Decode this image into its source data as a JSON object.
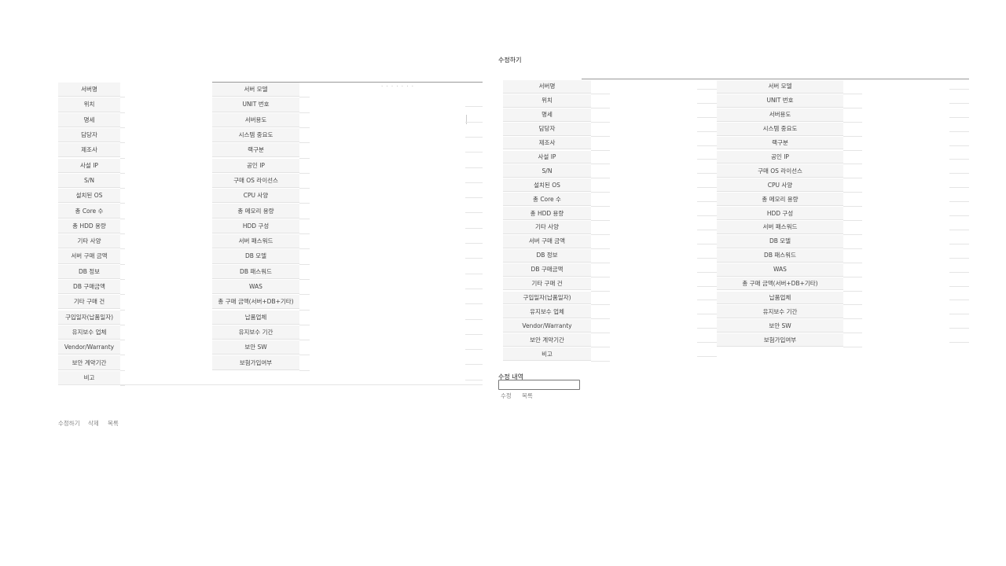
{
  "detail": {
    "left_labels": [
      "서버명",
      "위치",
      "명세",
      "담당자",
      "제조사",
      "사설 IP",
      "S/N",
      "설치된 OS",
      "총 Core 수",
      "총 HDD 용량",
      "기타 사양",
      "서버 구매 금액",
      "DB 정보",
      "DB 구매금액",
      "기타 구매 건",
      "구입일자(납품일자)",
      "유지보수 업체",
      "Vendor/Warranty",
      "보안 계약기간",
      "비고"
    ],
    "right_labels": [
      "서버 모델",
      "UNIT 번호",
      "서버용도",
      "시스템 중요도",
      "랙구분",
      "공인 IP",
      "구매 OS 라이선스",
      "CPU 사양",
      "총 메모리 용량",
      "HDD 구성",
      "서버 패스워드",
      "DB 모델",
      "DB 패스워드",
      "WAS",
      "총 구매 금액(서버+DB+기타)",
      "납품업체",
      "유지보수 기간",
      "보안 SW",
      "보험가입여부"
    ],
    "dots": "· · · · · · ·",
    "actions": {
      "edit": "수정하기",
      "delete": "삭제",
      "list": "목록"
    }
  },
  "edit": {
    "title": "수정하기",
    "left_labels": [
      "서버명",
      "위치",
      "명세",
      "담당자",
      "제조사",
      "사설 IP",
      "S/N",
      "설치된 OS",
      "총 Core 수",
      "총 HDD 용량",
      "기타 사양",
      "서버 구매 금액",
      "DB 정보",
      "DB 구매금액",
      "기타 구매 건",
      "구입일자(납품일자)",
      "유지보수 업체",
      "Vendor/Warranty",
      "보안 계약기간",
      "비고"
    ],
    "right_labels": [
      "서버 모델",
      "UNIT 번호",
      "서버용도",
      "시스템 중요도",
      "랙구분",
      "공인 IP",
      "구매 OS 라이선스",
      "CPU 사양",
      "총 메모리 용량",
      "HDD 구성",
      "서버 패스워드",
      "DB 모델",
      "DB 패스워드",
      "WAS",
      "총 구매 금액(서버+DB+기타)",
      "납품업체",
      "유지보수 기간",
      "보안 SW",
      "보험가입여부"
    ],
    "history_label": "수정 내역",
    "history_value": "",
    "actions": {
      "save": "수정",
      "list": "목록"
    }
  }
}
